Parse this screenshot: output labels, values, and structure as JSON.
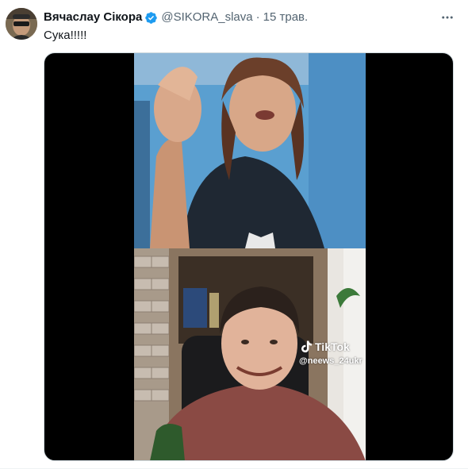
{
  "tweet": {
    "display_name": "Вячаслау Сікора",
    "handle": "@SIKORA_slava",
    "separator": "·",
    "date": "15 трав.",
    "text": "Сука!!!!!",
    "verified": true
  },
  "media": {
    "watermark_brand": "TikTok",
    "watermark_handle": "@neews_24ukr"
  },
  "colors": {
    "text_primary": "#0f1419",
    "text_secondary": "#536471",
    "verified_blue": "#1d9bf0",
    "media_background": "#000000"
  },
  "icons": {
    "verified": "verified-badge-icon",
    "more": "more-dots-icon",
    "tiktok": "tiktok-logo-icon"
  }
}
